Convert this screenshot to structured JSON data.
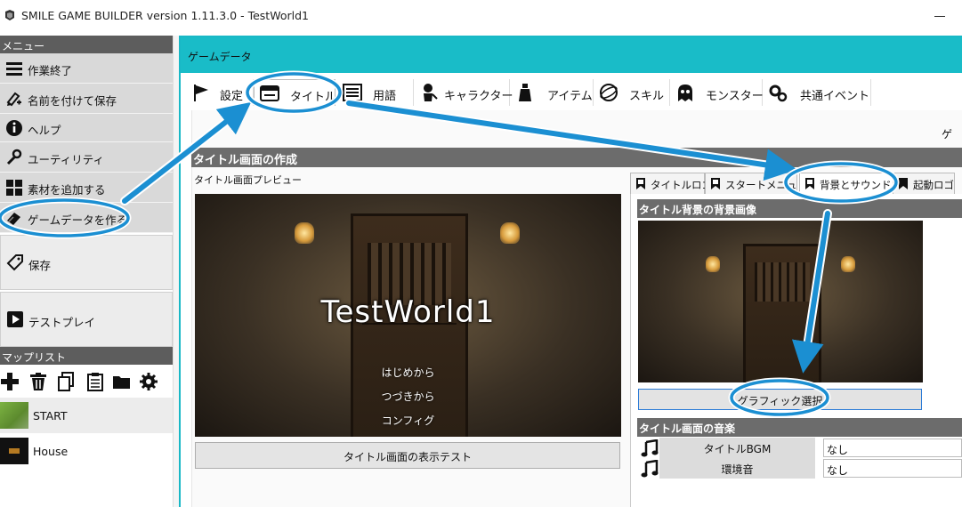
{
  "window": {
    "title": "SMILE GAME BUILDER version 1.11.3.0 - TestWorld1"
  },
  "menu": {
    "header": "メニュー",
    "items": [
      {
        "label": "作業終了",
        "icon": "hamburger-icon"
      },
      {
        "label": "名前を付けて保存",
        "icon": "save-as-icon"
      },
      {
        "label": "ヘルプ",
        "icon": "info-icon"
      },
      {
        "label": "ユーティリティ",
        "icon": "wrench-icon"
      },
      {
        "label": "素材を追加する",
        "icon": "grid-icon"
      },
      {
        "label": "ゲームデータを作る",
        "icon": "eraser-icon"
      },
      {
        "label": "保存",
        "icon": "tag-icon"
      },
      {
        "label": "テストプレイ",
        "icon": "play-icon"
      }
    ]
  },
  "maplist": {
    "header": "マップリスト",
    "maps": [
      {
        "label": "START"
      },
      {
        "label": "House"
      }
    ]
  },
  "main": {
    "header": "ゲームデータ",
    "tabs": [
      {
        "label": "設定"
      },
      {
        "label": "タイトル"
      },
      {
        "label": "用語"
      },
      {
        "label": "キャラクター"
      },
      {
        "label": "アイテム"
      },
      {
        "label": "スキル"
      },
      {
        "label": "モンスター"
      },
      {
        "label": "共通イベント"
      }
    ],
    "cut_label": "ゲー",
    "section_title": "タイトル画面の作成",
    "preview_label": "タイトル画面プレビュー",
    "preview": {
      "title": "TestWorld1",
      "menu": [
        "はじめから",
        "つづきから",
        "コンフィグ"
      ]
    },
    "test_button": "タイトル画面の表示テスト",
    "subtabs": [
      "タイトルロゴ",
      "スタートメニュー",
      "背景とサウンド",
      "起動ロゴ"
    ],
    "bg_header": "タイトル背景の背景画像",
    "graphic_button": "グラフィック選択",
    "music_header": "タイトル画面の音楽",
    "sounds": [
      {
        "name": "タイトルBGM",
        "value": "なし"
      },
      {
        "name": "環境音",
        "value": "なし"
      }
    ]
  },
  "colors": {
    "accent": "#19bcc8",
    "annotation": "#1b8fd2"
  }
}
